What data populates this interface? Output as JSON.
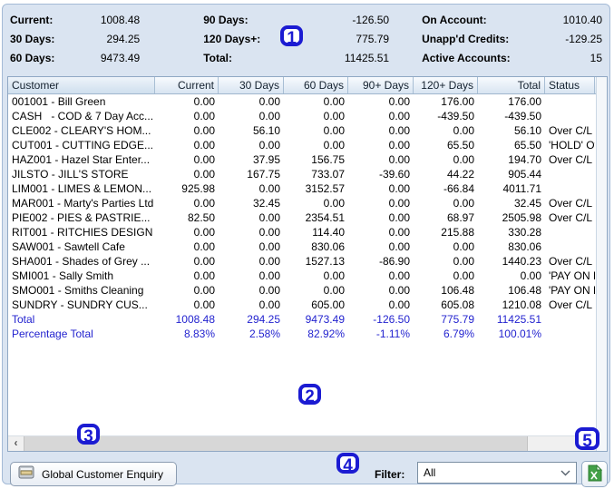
{
  "summary": {
    "columns": [
      {
        "items": [
          {
            "label": "Current:",
            "value": "1008.48"
          },
          {
            "label": "30 Days:",
            "value": "294.25"
          },
          {
            "label": "60 Days:",
            "value": "9473.49"
          }
        ]
      },
      {
        "items": [
          {
            "label": "90 Days:",
            "value": "-126.50"
          },
          {
            "label": "120 Days+:",
            "value": "775.79"
          },
          {
            "label": "Total:",
            "value": "11425.51"
          }
        ]
      },
      {
        "items": [
          {
            "label": "On Account:",
            "value": "1010.40"
          },
          {
            "label": "Unapp'd Credits:",
            "value": "-129.25"
          },
          {
            "label": "Active Accounts:",
            "value": "15"
          }
        ]
      }
    ]
  },
  "table": {
    "columns": [
      "Customer",
      "Current",
      "30 Days",
      "60 Days",
      "90+ Days",
      "120+ Days",
      "Total",
      "Status"
    ],
    "rows": [
      {
        "name": "001001 - Bill Green",
        "values": [
          "0.00",
          "0.00",
          "0.00",
          "0.00",
          "176.00",
          "176.00"
        ],
        "status": ""
      },
      {
        "name": "CASH   - COD & 7 Day Acc...",
        "values": [
          "0.00",
          "0.00",
          "0.00",
          "0.00",
          "-439.50",
          "-439.50"
        ],
        "status": ""
      },
      {
        "name": "CLE002 - CLEARY'S HOM...",
        "values": [
          "0.00",
          "56.10",
          "0.00",
          "0.00",
          "0.00",
          "56.10"
        ],
        "status": "Over C/L"
      },
      {
        "name": "CUT001 - CUTTING EDGE...",
        "values": [
          "0.00",
          "0.00",
          "0.00",
          "0.00",
          "65.50",
          "65.50"
        ],
        "status": "'HOLD' Over C/L"
      },
      {
        "name": "HAZ001 - Hazel Star Enter...",
        "values": [
          "0.00",
          "37.95",
          "156.75",
          "0.00",
          "0.00",
          "194.70"
        ],
        "status": "Over C/L"
      },
      {
        "name": "JILSTO - JILL'S STORE",
        "values": [
          "0.00",
          "167.75",
          "733.07",
          "-39.60",
          "44.22",
          "905.44"
        ],
        "status": ""
      },
      {
        "name": "LIM001 - LIMES & LEMON...",
        "values": [
          "925.98",
          "0.00",
          "3152.57",
          "0.00",
          "-66.84",
          "4011.71"
        ],
        "status": ""
      },
      {
        "name": "MAR001 - Marty's Parties Ltd",
        "values": [
          "0.00",
          "32.45",
          "0.00",
          "0.00",
          "0.00",
          "32.45"
        ],
        "status": "Over C/L"
      },
      {
        "name": "PIE002 - PIES & PASTRIE...",
        "values": [
          "82.50",
          "0.00",
          "2354.51",
          "0.00",
          "68.97",
          "2505.98"
        ],
        "status": "Over C/L"
      },
      {
        "name": "RIT001 - RITCHIES DESIGN",
        "values": [
          "0.00",
          "0.00",
          "114.40",
          "0.00",
          "215.88",
          "330.28"
        ],
        "status": ""
      },
      {
        "name": "SAW001 - Sawtell Cafe",
        "values": [
          "0.00",
          "0.00",
          "830.06",
          "0.00",
          "0.00",
          "830.06"
        ],
        "status": ""
      },
      {
        "name": "SHA001 - Shades of Grey ...",
        "values": [
          "0.00",
          "0.00",
          "1527.13",
          "-86.90",
          "0.00",
          "1440.23"
        ],
        "status": "Over C/L"
      },
      {
        "name": "SMI001 - Sally Smith",
        "values": [
          "0.00",
          "0.00",
          "0.00",
          "0.00",
          "0.00",
          "0.00"
        ],
        "status": "'PAY ON PICKUP'"
      },
      {
        "name": "SMO001 - Smiths Cleaning",
        "values": [
          "0.00",
          "0.00",
          "0.00",
          "0.00",
          "106.48",
          "106.48"
        ],
        "status": "'PAY ON PICKUP'"
      },
      {
        "name": "SUNDRY - SUNDRY CUS...",
        "values": [
          "0.00",
          "0.00",
          "605.00",
          "0.00",
          "605.08",
          "1210.08"
        ],
        "status": "Over C/L"
      }
    ],
    "total_row": {
      "label": "Total",
      "values": [
        "1008.48",
        "294.25",
        "9473.49",
        "-126.50",
        "775.79",
        "11425.51"
      ]
    },
    "percentage_row": {
      "label": "Percentage Total",
      "values": [
        "8.83%",
        "2.58%",
        "82.92%",
        "-1.11%",
        "6.79%",
        "100.01%"
      ]
    }
  },
  "footer": {
    "enquiry_button": "Global Customer Enquiry",
    "filter_label": "Filter:",
    "filter_value": "All"
  },
  "badges": [
    "1",
    "2",
    "3",
    "4",
    "5"
  ],
  "colors": {
    "badge_blue": "#1b1bd2",
    "totals_blue": "#2323cf",
    "excel_green": "#43a047",
    "panel_background": "#dae4f1"
  }
}
